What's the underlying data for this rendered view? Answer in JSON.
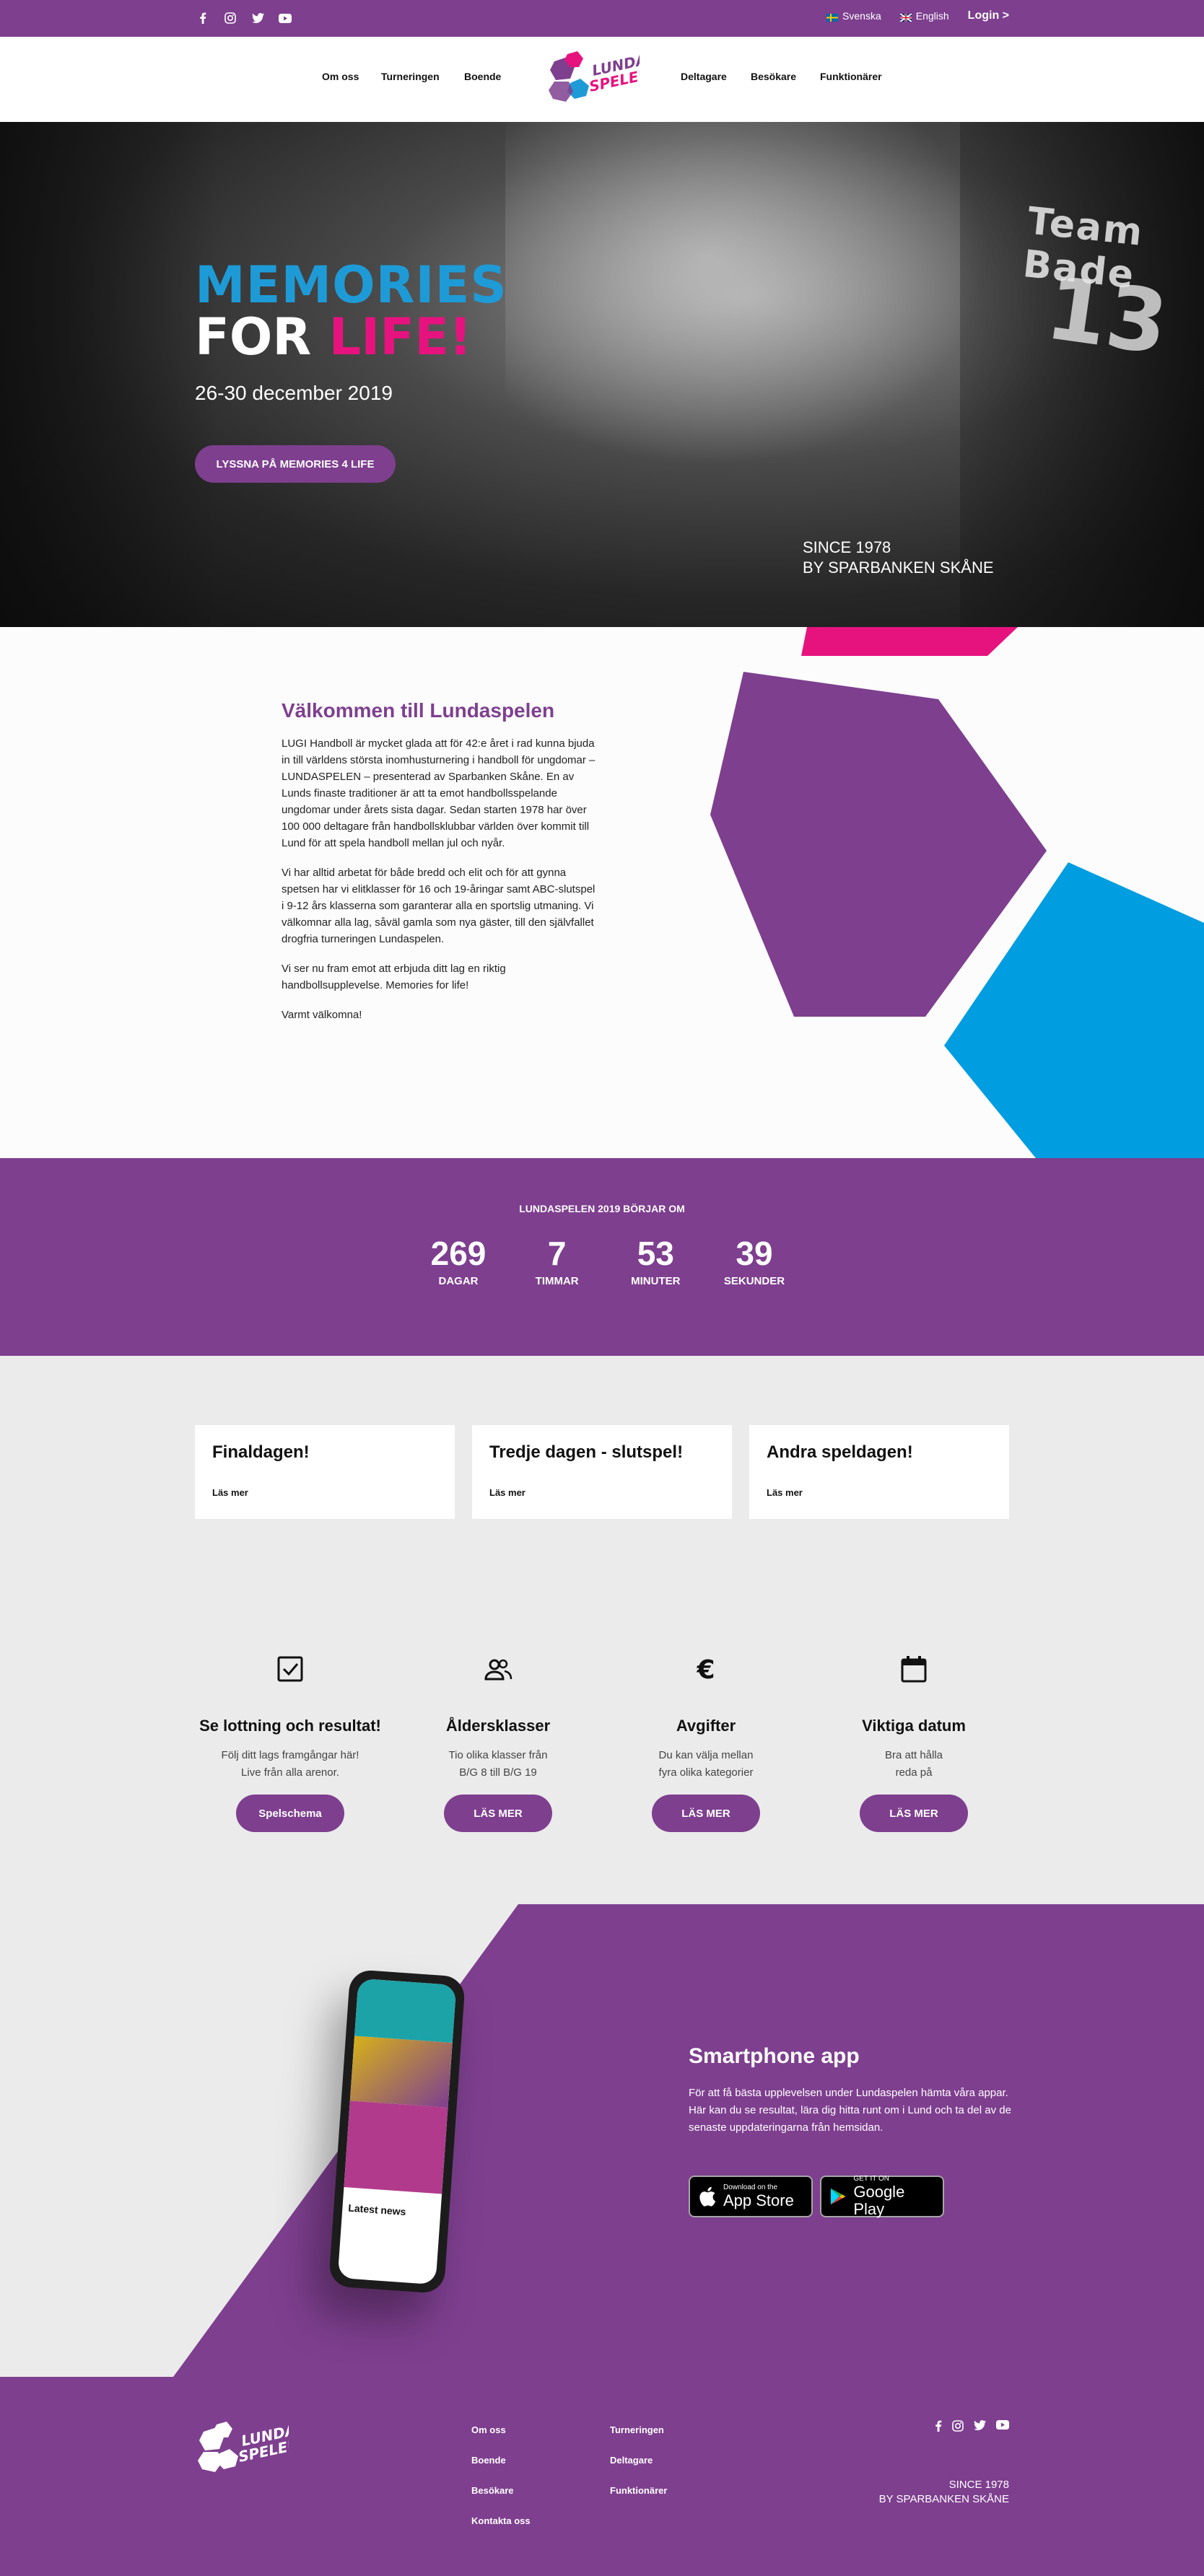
{
  "topbar": {
    "socials": [
      "facebook-icon",
      "instagram-icon",
      "twitter-icon",
      "youtube-icon"
    ],
    "lang_sv": "Svenska",
    "lang_en": "English",
    "login": "Login >"
  },
  "nav": {
    "items_left": [
      "Om oss",
      "Turneringen",
      "Boende"
    ],
    "items_right": [
      "Deltagare",
      "Besökare",
      "Funktionärer"
    ],
    "logo_line1": "LUNDA",
    "logo_line2": "SPELEN"
  },
  "hero": {
    "title_line1": "MEMORIES",
    "title_for": "FOR ",
    "title_life": "LIFE!",
    "date": "26-30 december 2019",
    "button": "LYSSNA PÅ MEMORIES 4 LIFE",
    "since_line1": "SINCE 1978",
    "since_line2": "BY SPARBANKEN SKÅNE",
    "jersey_text": "Team Bade",
    "jersey_num": "13"
  },
  "welcome": {
    "title": "Välkommen till Lundaspelen",
    "p1": "LUGI Handboll är mycket glada att för 42:e året i rad kunna bjuda in till världens största inomhusturnering i handboll för ungdomar – LUNDASPELEN – presenterad av Sparbanken Skåne. En av Lunds finaste traditioner är att ta emot handbollsspelande ungdomar under årets sista dagar. Sedan starten 1978 har över 100 000 deltagare från handbollsklubbar världen över kommit till Lund för att spela handboll mellan jul och nyår.",
    "p2": "Vi har alltid arbetat för både bredd och elit och för att gynna spetsen har vi elitklasser för 16 och 19-åringar samt ABC-slutspel i 9-12 års klasserna som garanterar alla en sportslig utmaning. Vi välkomnar alla lag, såväl gamla som nya gäster, till den självfallet drogfria turneringen Lundaspelen.",
    "p3": "Vi ser nu fram emot att erbjuda ditt lag en riktig handbollsupplevelse.  Memories for life!",
    "p4": "Varmt välkomna!"
  },
  "countdown": {
    "label": "LUNDASPELEN 2019 BÖRJAR OM",
    "units": [
      {
        "value": "269",
        "label": "DAGAR"
      },
      {
        "value": "7",
        "label": "TIMMAR"
      },
      {
        "value": "53",
        "label": "MINUTER"
      },
      {
        "value": "39",
        "label": "SEKUNDER"
      }
    ]
  },
  "cards": [
    {
      "title": "Finaldagen!",
      "link": "Läs mer"
    },
    {
      "title": "Tredje dagen - slutspel!",
      "link": "Läs mer"
    },
    {
      "title": "Andra speldagen!",
      "link": "Läs mer"
    }
  ],
  "features": [
    {
      "icon": "checkbox-icon",
      "title": "Se lottning och resultat!",
      "desc": "Följ ditt lags framgångar här!\nLive från alla arenor.",
      "button": "Spelschema"
    },
    {
      "icon": "people-icon",
      "title": "Åldersklasser",
      "desc": "Tio olika klasser från\nB/G 8 till B/G 19",
      "button": "LÄS MER"
    },
    {
      "icon": "euro-icon",
      "title": "Avgifter",
      "desc": "Du kan välja mellan\nfyra olika kategorier",
      "button": "LÄS MER"
    },
    {
      "icon": "calendar-icon",
      "title": "Viktiga datum",
      "desc": "Bra att hålla\nreda på",
      "button": "LÄS MER"
    }
  ],
  "app": {
    "title": "Smartphone app",
    "desc": "För att få bästa upplevelsen under Lundaspelen hämta våra appar. Här kan du se resultat, lära dig hitta runt om i Lund och ta del av de senaste uppdateringarna från hemsidan.",
    "appstore_small": "Download on the",
    "appstore_big": "App Store",
    "googleplay_small": "GET IT ON",
    "googleplay_big": "Google Play",
    "phone_latest": "Latest news"
  },
  "footer": {
    "col1": [
      "Om oss",
      "Boende",
      "Besökare",
      "Kontakta oss"
    ],
    "col2": [
      "Turneringen",
      "Deltagare",
      "Funktionärer"
    ],
    "since_line1": "SINCE 1978",
    "since_line2": "BY SPARBANKEN SKÅNE"
  },
  "colors": {
    "purple": "#7e3f8f",
    "pink": "#e6137f",
    "blue": "#1e9bd7",
    "grey_bg": "#ebebeb"
  }
}
